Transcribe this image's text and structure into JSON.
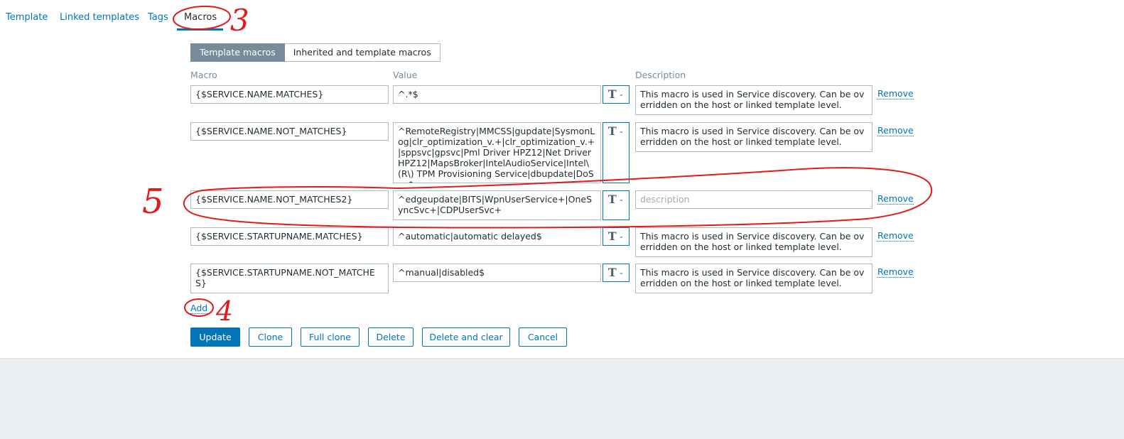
{
  "tabs": [
    {
      "label": "Template"
    },
    {
      "label": "Linked templates"
    },
    {
      "label": "Tags"
    },
    {
      "label": "Macros"
    }
  ],
  "segments": [
    "Template macros",
    "Inherited and template macros"
  ],
  "columns": {
    "macro": "Macro",
    "value": "Value",
    "description": "Description"
  },
  "rows": [
    {
      "macro": "{$SERVICE.NAME.MATCHES}",
      "value": "^.*$",
      "description": "This macro is used in Service discovery. Can be overridden on the host or linked template level."
    },
    {
      "macro": "{$SERVICE.NAME.NOT_MATCHES}",
      "value": "^RemoteRegistry|MMCSS|gupdate|SysmonLog|clr_optimization_v.+|clr_optimization_v.+|sppsvc|gpsvc|Pml Driver HPZ12|Net Driver HPZ12|MapsBroker|IntelAudioService|Intel\\(R\\) TPM Provisioning Service|dbupdate|DoSvc$",
      "description": "This macro is used in Service discovery. Can be overridden on the host or linked template level."
    },
    {
      "macro": "{$SERVICE.NAME.NOT_MATCHES2}",
      "value": "^edgeupdate|BITS|WpnUserService+|OneSyncSvc+|CDPUserSvc+",
      "description": "",
      "description_placeholder": "description"
    },
    {
      "macro": "{$SERVICE.STARTUPNAME.MATCHES}",
      "value": "^automatic|automatic delayed$",
      "description": "This macro is used in Service discovery. Can be overridden on the host or linked template level."
    },
    {
      "macro": "{$SERVICE.STARTUPNAME.NOT_MATCHES}",
      "value": "^manual|disabled$",
      "description": "This macro is used in Service discovery. Can be overridden on the host or linked template level."
    }
  ],
  "type_button_icon": "T",
  "remove_label": "Remove",
  "add_label": "Add",
  "actions": [
    "Update",
    "Clone",
    "Full clone",
    "Delete",
    "Delete and clear",
    "Cancel"
  ],
  "annotations": {
    "n3": "3",
    "n4": "4",
    "n5": "5"
  },
  "colors": {
    "accent": "#0275b8",
    "annotation": "#e21a1a",
    "active_segment": "#768d99"
  }
}
